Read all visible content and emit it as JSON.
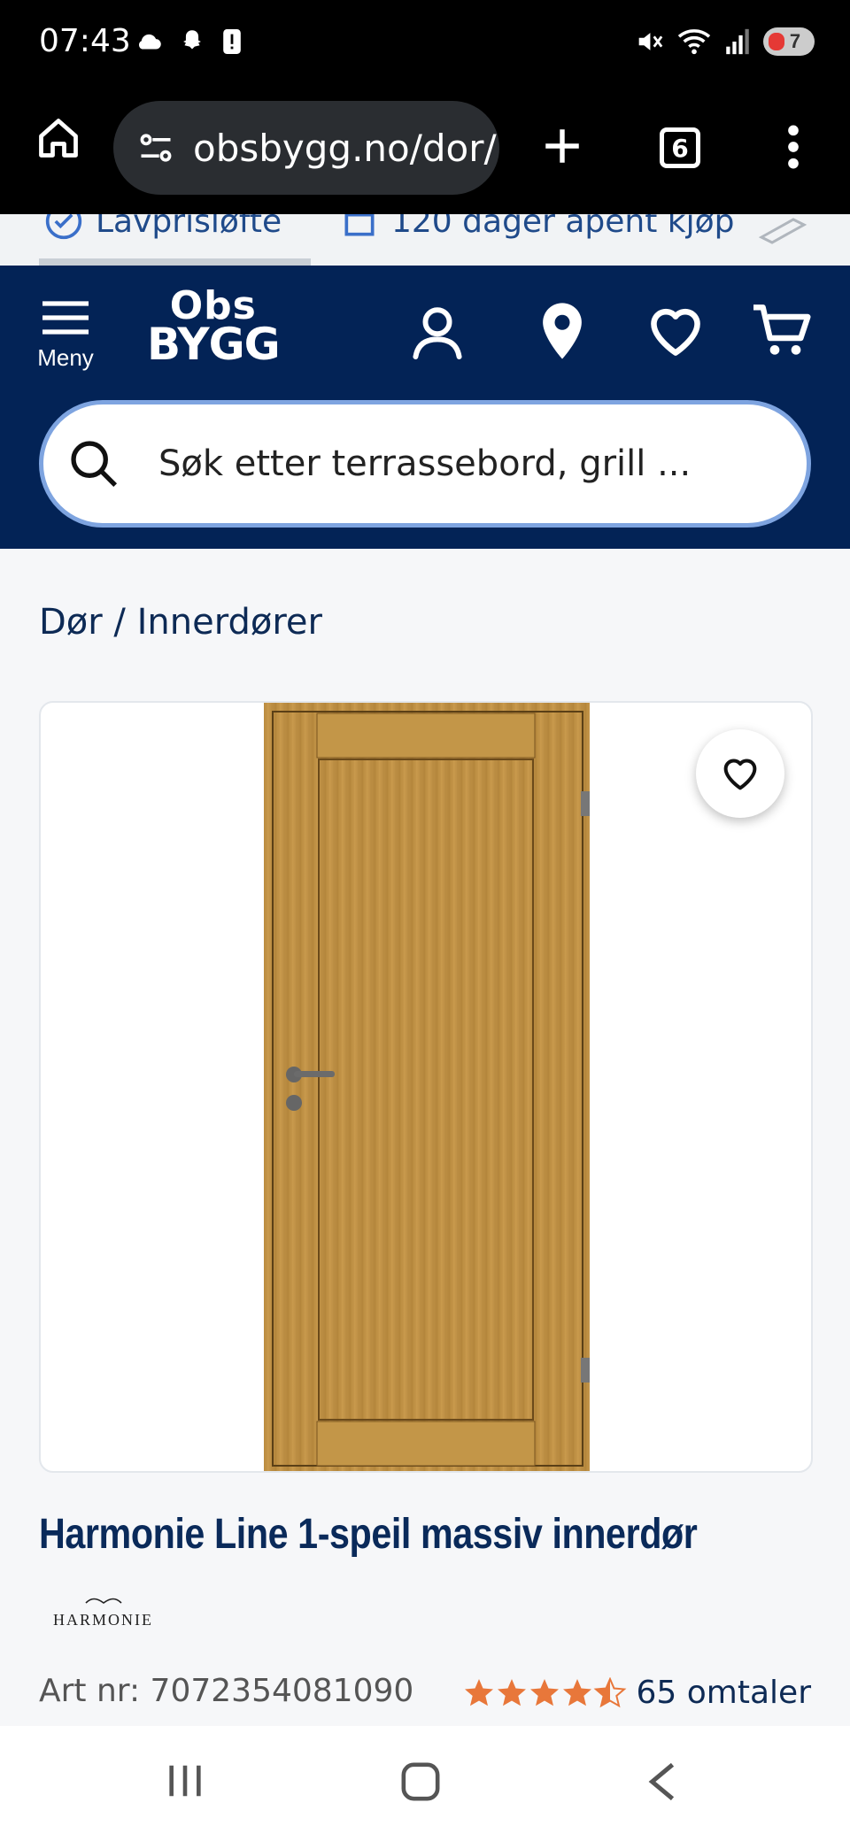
{
  "status_bar": {
    "time": "07:43",
    "battery_level": "7",
    "wifi_badge": "6",
    "icons": [
      "cloud-icon",
      "snapchat-icon",
      "alert-icon",
      "mute-icon",
      "wifi-icon",
      "signal-icon",
      "battery-icon"
    ]
  },
  "browser": {
    "url": "obsbygg.no/dor/ir",
    "tab_count": "6"
  },
  "promo": {
    "items": [
      "Lavprisløfte",
      "120 dager åpent kjøp"
    ],
    "progress_fraction": 0.32
  },
  "header": {
    "menu_label": "Meny",
    "logo_top": "Obs",
    "logo_bottom": "BYGG",
    "search_placeholder": "Søk etter terrassebord, grill ..."
  },
  "breadcrumb": "Dør / Innerdører",
  "product": {
    "title": "Harmonie Line 1-speil massiv innerdør",
    "brand": "HARMONIE",
    "art_nr": "Art nr: 7072354081090",
    "rating": 4.5,
    "reviews_label": "65 omtaler"
  },
  "colors": {
    "header_bg": "#032356",
    "accent_star": "#e8773a",
    "text_navy": "#0a2a5a"
  }
}
